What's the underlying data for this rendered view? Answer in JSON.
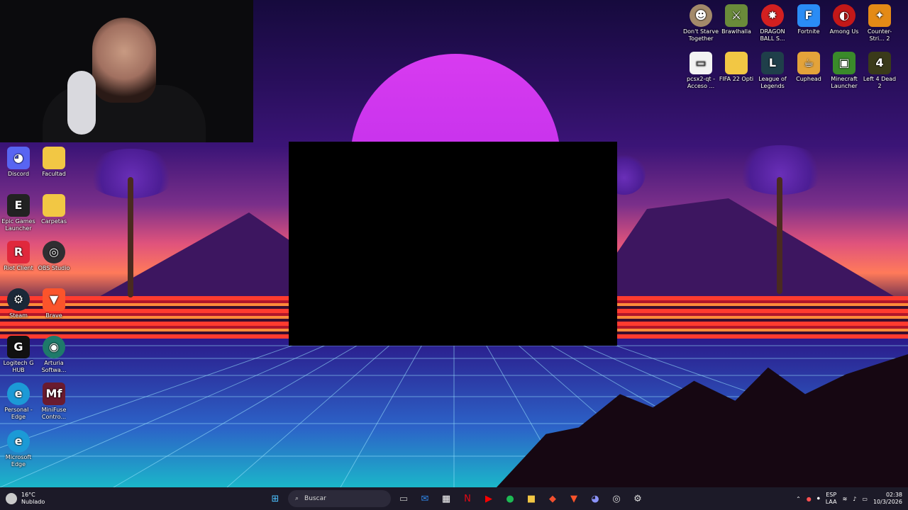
{
  "desktop_icons_left": [
    {
      "label": "Discord",
      "icon": "discord-icon",
      "color": "#5865f2"
    },
    {
      "label": "Facultad",
      "icon": "folder-icon",
      "color": "#f2c744"
    },
    {
      "label": "Epic Games Launcher",
      "icon": "epic-games-icon",
      "color": "#222222"
    },
    {
      "label": "Carpetas",
      "icon": "folder-icon",
      "color": "#f2c744"
    },
    {
      "label": "Riot Client",
      "icon": "riot-icon",
      "color": "#e0283c"
    },
    {
      "label": "OBS Studio",
      "icon": "obs-icon",
      "color": "#302e31"
    },
    {
      "label": "Steam",
      "icon": "steam-icon",
      "color": "#1b2838"
    },
    {
      "label": "Brave",
      "icon": "brave-icon",
      "color": "#fb542b"
    },
    {
      "label": "Logitech G HUB",
      "icon": "logitech-icon",
      "color": "#111111"
    },
    {
      "label": "Arturia Softwa...",
      "icon": "arturia-icon",
      "color": "#1e7a6a"
    },
    {
      "label": "Personal - Edge",
      "icon": "edge-icon",
      "color": "#1c9ad6"
    },
    {
      "label": "MiniFuse Contro...",
      "icon": "minifuse-icon",
      "color": "#6a1b2f"
    },
    {
      "label": "Microsoft Edge",
      "icon": "edge-icon",
      "color": "#1c9ad6"
    }
  ],
  "desktop_icons_top_right": [
    {
      "label": "Don't Starve Together",
      "icon": "dont-starve-icon",
      "color": "#a38a6a"
    },
    {
      "label": "Brawlhalla",
      "icon": "brawlhalla-icon",
      "color": "#6a8b3a"
    },
    {
      "label": "DRAGON BALL S...",
      "icon": "dragonball-icon",
      "color": "#d32020"
    },
    {
      "label": "Fortnite",
      "icon": "fortnite-icon",
      "color": "#2a8cf5"
    },
    {
      "label": "Among Us",
      "icon": "among-us-icon",
      "color": "#c41818"
    },
    {
      "label": "Counter-Stri... 2",
      "icon": "cs2-icon",
      "color": "#e48a16"
    },
    {
      "label": "pcsx2-qt - Acceso ...",
      "icon": "file-icon",
      "color": "#f3f3f3"
    },
    {
      "label": "FIFA 22 Opti",
      "icon": "folder-icon",
      "color": "#f2c744"
    },
    {
      "label": "League of Legends",
      "icon": "league-icon",
      "color": "#1f3f4a"
    },
    {
      "label": "Cuphead",
      "icon": "cuphead-icon",
      "color": "#e3a33a"
    },
    {
      "label": "Minecraft Launcher",
      "icon": "minecraft-icon",
      "color": "#3a8a2a"
    },
    {
      "label": "Left 4 Dead 2",
      "icon": "l4d2-icon",
      "color": "#3a3a1a"
    }
  ],
  "taskbar": {
    "weather": {
      "temp": "16°C",
      "condition": "Nublado"
    },
    "search_placeholder": "Buscar",
    "pinned": [
      "file-explorer-icon",
      "mail-icon",
      "store-icon",
      "netflix-icon",
      "youtube-icon",
      "spotify-icon",
      "folder-icon",
      "git-icon",
      "brave-icon",
      "discord-icon",
      "obs-icon",
      "settings-icon"
    ],
    "lang_top": "ESP",
    "lang_bottom": "LAA",
    "time": "02:38",
    "date": "10/3/2026"
  }
}
